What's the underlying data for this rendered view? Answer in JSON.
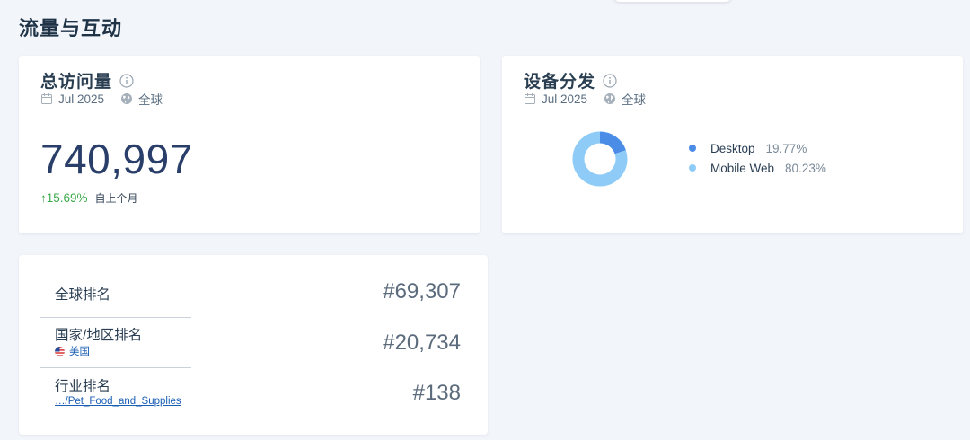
{
  "section_title": "流量与互动",
  "total_visits": {
    "title": "总访问量",
    "date": "Jul 2025",
    "region": "全球",
    "value": "740,997",
    "change": "↑15.69%",
    "change_label": "自上个月",
    "change_color": "#3aaa49"
  },
  "device_distribution": {
    "title": "设备分发",
    "date": "Jul 2025",
    "region": "全球",
    "chart_data": {
      "type": "pie",
      "categories": [
        "Desktop",
        "Mobile Web"
      ],
      "values": [
        19.77,
        80.23
      ],
      "colors": [
        "#4b8de6",
        "#8ecbf7"
      ],
      "labels": [
        "19.77%",
        "80.23%"
      ]
    }
  },
  "rankings": {
    "global": {
      "label": "全球排名",
      "value": "#69,307"
    },
    "country": {
      "label": "国家/地区排名",
      "sub": "美国",
      "sub_icon": "us-flag-icon",
      "value": "#20,734"
    },
    "category": {
      "label": "行业排名",
      "sub": "…/Pet_Food_and_Supplies",
      "value": "#138"
    }
  }
}
